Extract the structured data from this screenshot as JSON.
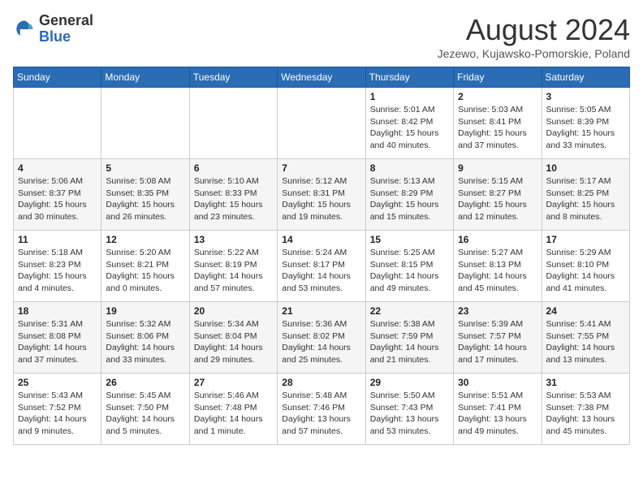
{
  "header": {
    "logo_general": "General",
    "logo_blue": "Blue",
    "month_title": "August 2024",
    "location": "Jezewo, Kujawsko-Pomorskie, Poland"
  },
  "days_of_week": [
    "Sunday",
    "Monday",
    "Tuesday",
    "Wednesday",
    "Thursday",
    "Friday",
    "Saturday"
  ],
  "weeks": [
    [
      {
        "day": "",
        "info": ""
      },
      {
        "day": "",
        "info": ""
      },
      {
        "day": "",
        "info": ""
      },
      {
        "day": "",
        "info": ""
      },
      {
        "day": "1",
        "info": "Sunrise: 5:01 AM\nSunset: 8:42 PM\nDaylight: 15 hours\nand 40 minutes."
      },
      {
        "day": "2",
        "info": "Sunrise: 5:03 AM\nSunset: 8:41 PM\nDaylight: 15 hours\nand 37 minutes."
      },
      {
        "day": "3",
        "info": "Sunrise: 5:05 AM\nSunset: 8:39 PM\nDaylight: 15 hours\nand 33 minutes."
      }
    ],
    [
      {
        "day": "4",
        "info": "Sunrise: 5:06 AM\nSunset: 8:37 PM\nDaylight: 15 hours\nand 30 minutes."
      },
      {
        "day": "5",
        "info": "Sunrise: 5:08 AM\nSunset: 8:35 PM\nDaylight: 15 hours\nand 26 minutes."
      },
      {
        "day": "6",
        "info": "Sunrise: 5:10 AM\nSunset: 8:33 PM\nDaylight: 15 hours\nand 23 minutes."
      },
      {
        "day": "7",
        "info": "Sunrise: 5:12 AM\nSunset: 8:31 PM\nDaylight: 15 hours\nand 19 minutes."
      },
      {
        "day": "8",
        "info": "Sunrise: 5:13 AM\nSunset: 8:29 PM\nDaylight: 15 hours\nand 15 minutes."
      },
      {
        "day": "9",
        "info": "Sunrise: 5:15 AM\nSunset: 8:27 PM\nDaylight: 15 hours\nand 12 minutes."
      },
      {
        "day": "10",
        "info": "Sunrise: 5:17 AM\nSunset: 8:25 PM\nDaylight: 15 hours\nand 8 minutes."
      }
    ],
    [
      {
        "day": "11",
        "info": "Sunrise: 5:18 AM\nSunset: 8:23 PM\nDaylight: 15 hours\nand 4 minutes."
      },
      {
        "day": "12",
        "info": "Sunrise: 5:20 AM\nSunset: 8:21 PM\nDaylight: 15 hours\nand 0 minutes."
      },
      {
        "day": "13",
        "info": "Sunrise: 5:22 AM\nSunset: 8:19 PM\nDaylight: 14 hours\nand 57 minutes."
      },
      {
        "day": "14",
        "info": "Sunrise: 5:24 AM\nSunset: 8:17 PM\nDaylight: 14 hours\nand 53 minutes."
      },
      {
        "day": "15",
        "info": "Sunrise: 5:25 AM\nSunset: 8:15 PM\nDaylight: 14 hours\nand 49 minutes."
      },
      {
        "day": "16",
        "info": "Sunrise: 5:27 AM\nSunset: 8:13 PM\nDaylight: 14 hours\nand 45 minutes."
      },
      {
        "day": "17",
        "info": "Sunrise: 5:29 AM\nSunset: 8:10 PM\nDaylight: 14 hours\nand 41 minutes."
      }
    ],
    [
      {
        "day": "18",
        "info": "Sunrise: 5:31 AM\nSunset: 8:08 PM\nDaylight: 14 hours\nand 37 minutes."
      },
      {
        "day": "19",
        "info": "Sunrise: 5:32 AM\nSunset: 8:06 PM\nDaylight: 14 hours\nand 33 minutes."
      },
      {
        "day": "20",
        "info": "Sunrise: 5:34 AM\nSunset: 8:04 PM\nDaylight: 14 hours\nand 29 minutes."
      },
      {
        "day": "21",
        "info": "Sunrise: 5:36 AM\nSunset: 8:02 PM\nDaylight: 14 hours\nand 25 minutes."
      },
      {
        "day": "22",
        "info": "Sunrise: 5:38 AM\nSunset: 7:59 PM\nDaylight: 14 hours\nand 21 minutes."
      },
      {
        "day": "23",
        "info": "Sunrise: 5:39 AM\nSunset: 7:57 PM\nDaylight: 14 hours\nand 17 minutes."
      },
      {
        "day": "24",
        "info": "Sunrise: 5:41 AM\nSunset: 7:55 PM\nDaylight: 14 hours\nand 13 minutes."
      }
    ],
    [
      {
        "day": "25",
        "info": "Sunrise: 5:43 AM\nSunset: 7:52 PM\nDaylight: 14 hours\nand 9 minutes."
      },
      {
        "day": "26",
        "info": "Sunrise: 5:45 AM\nSunset: 7:50 PM\nDaylight: 14 hours\nand 5 minutes."
      },
      {
        "day": "27",
        "info": "Sunrise: 5:46 AM\nSunset: 7:48 PM\nDaylight: 14 hours\nand 1 minute."
      },
      {
        "day": "28",
        "info": "Sunrise: 5:48 AM\nSunset: 7:46 PM\nDaylight: 13 hours\nand 57 minutes."
      },
      {
        "day": "29",
        "info": "Sunrise: 5:50 AM\nSunset: 7:43 PM\nDaylight: 13 hours\nand 53 minutes."
      },
      {
        "day": "30",
        "info": "Sunrise: 5:51 AM\nSunset: 7:41 PM\nDaylight: 13 hours\nand 49 minutes."
      },
      {
        "day": "31",
        "info": "Sunrise: 5:53 AM\nSunset: 7:38 PM\nDaylight: 13 hours\nand 45 minutes."
      }
    ]
  ]
}
